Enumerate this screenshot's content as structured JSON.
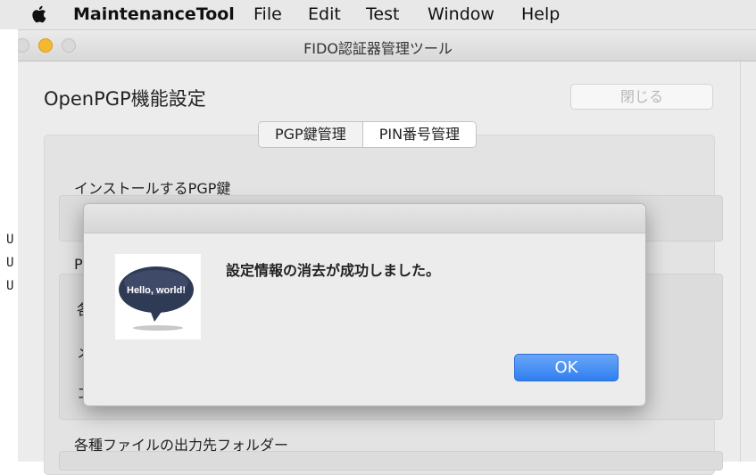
{
  "menubar": {
    "app": "MaintenanceTool",
    "items": [
      "File",
      "Edit",
      "Test",
      "Window",
      "Help"
    ]
  },
  "background_terminal": [
    "U",
    "U",
    "U"
  ],
  "window": {
    "title": "FIDO認証器管理ツール",
    "page_title": "OpenPGP機能設定",
    "close_label": "閉じる",
    "tabs": [
      "PGP鍵管理",
      "PIN番号管理"
    ],
    "selected_tab": "PIN番号管理",
    "sections": {
      "install_key": "インストールするPGP鍵",
      "partial_p": "P",
      "partial_kaku": "各",
      "partial_me": "メ",
      "partial_ko": "コ",
      "output_folder": "各種ファイルの出力先フォルダー"
    }
  },
  "dialog": {
    "icon_text": "Hello, world!",
    "message": "設定情報の消去が成功しました。",
    "ok_label": "OK"
  },
  "colors": {
    "ok_button": "#2f7ff0",
    "minimize_light": "#f5b931"
  }
}
